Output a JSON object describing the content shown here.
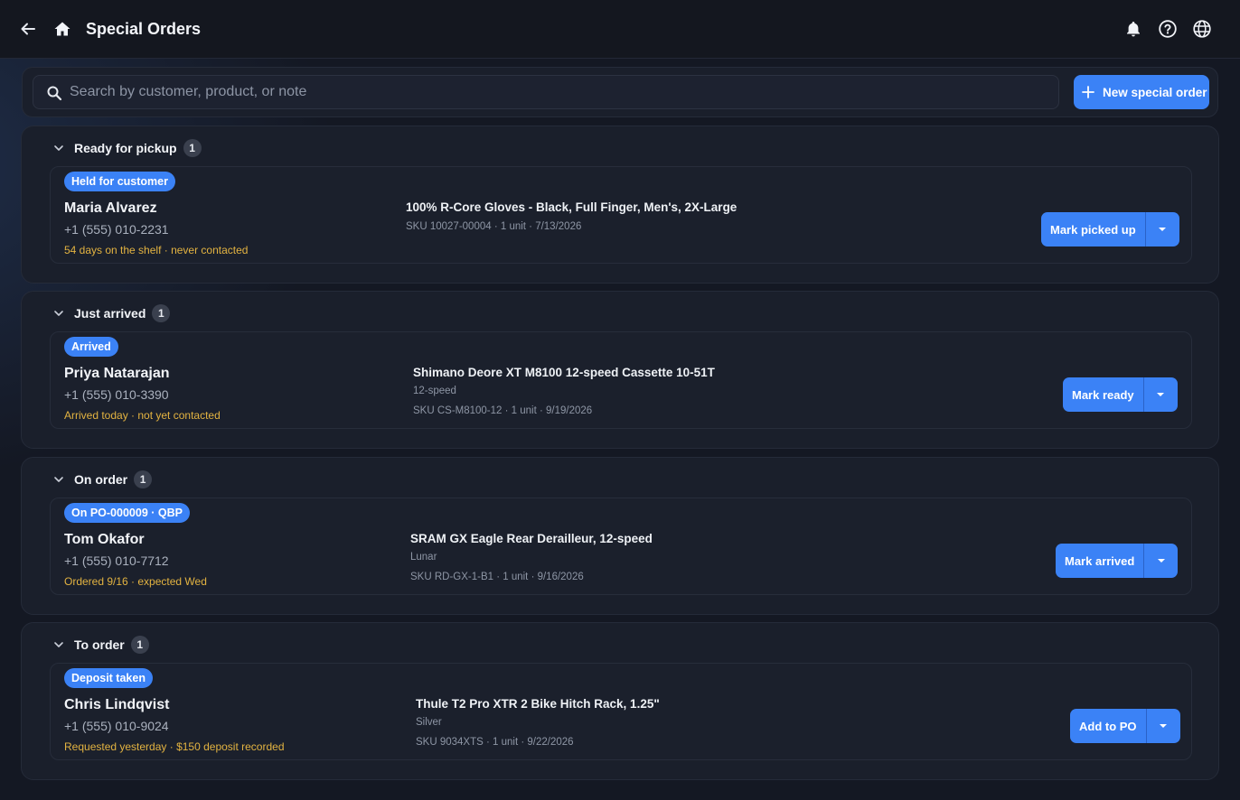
{
  "header": {
    "title": "Special Orders",
    "back_icon": "arrow-left-icon",
    "home_icon": "home-icon",
    "notifications_icon": "bell-icon",
    "help_icon": "help-circle-icon",
    "language_icon": "globe-icon"
  },
  "search": {
    "placeholder": "Search by customer, product, or note",
    "value": ""
  },
  "actions": {
    "new_order_label": "New special order"
  },
  "colors": {
    "accent": "#3b82f6",
    "warning_text": "#e3b341",
    "background": "#141823"
  },
  "sections": [
    {
      "title": "Ready for pickup",
      "count": "1",
      "order": {
        "status": "Held for customer",
        "customer": "Maria Alvarez",
        "phone": "+1 (555) 010-2231",
        "note": "54 days on the shelf · never contacted",
        "product": "100% R-Core Gloves - Black, Full Finger, Men's, 2X-Large",
        "variant": "",
        "meta": "SKU 10027-00004 · 1 unit · 7/13/2026",
        "action": "Mark picked up"
      }
    },
    {
      "title": "Just arrived",
      "count": "1",
      "order": {
        "status": "Arrived",
        "customer": "Priya Natarajan",
        "phone": "+1 (555) 010-3390",
        "note": "Arrived today · not yet contacted",
        "product": "Shimano Deore XT M8100 12-speed Cassette 10-51T",
        "variant": "12-speed",
        "meta": "SKU CS-M8100-12 · 1 unit · 9/19/2026",
        "action": "Mark ready"
      }
    },
    {
      "title": "On order",
      "count": "1",
      "order": {
        "status": "On PO-000009 · QBP",
        "customer": "Tom Okafor",
        "phone": "+1 (555) 010-7712",
        "note": "Ordered 9/16 · expected Wed",
        "product": "SRAM GX Eagle Rear Derailleur, 12-speed",
        "variant": "Lunar",
        "meta": "SKU RD-GX-1-B1 · 1 unit · 9/16/2026",
        "action": "Mark arrived"
      }
    },
    {
      "title": "To order",
      "count": "1",
      "order": {
        "status": "Deposit taken",
        "customer": "Chris Lindqvist",
        "phone": "+1 (555) 010-9024",
        "note": "Requested yesterday · $150 deposit recorded",
        "product": "Thule T2 Pro XTR 2 Bike Hitch Rack, 1.25\"",
        "variant": "Silver",
        "meta": "SKU 9034XTS · 1 unit · 9/22/2026",
        "action": "Add to PO"
      }
    }
  ]
}
